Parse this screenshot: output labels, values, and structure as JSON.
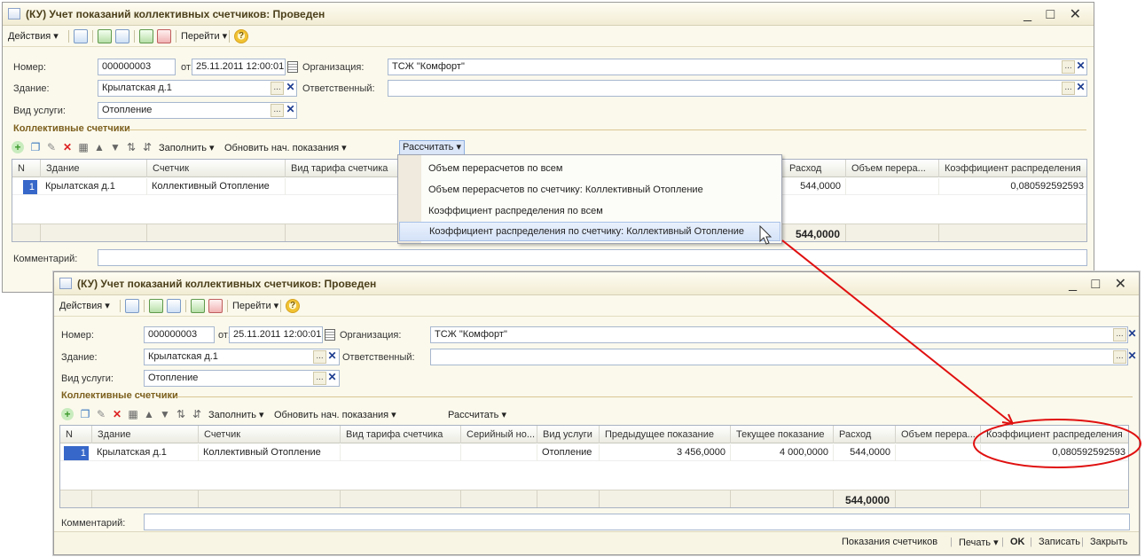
{
  "window": {
    "title": "(КУ) Учет показаний коллективных счетчиков: Проведен",
    "controls": "_ □ ✕"
  },
  "toolbar": {
    "actions": "Действия ▾",
    "goto": "Перейти ▾",
    "help": "?"
  },
  "form": {
    "number_label": "Номер:",
    "number_value": "000000003",
    "date_label": "от:",
    "date_value": "25.11.2011 12:00:01",
    "org_label": "Организация:",
    "org_value": "ТСЖ \"Комфорт\"",
    "building_label": "Здание:",
    "building_value": "Крылатская д.1",
    "responsible_label": "Ответственный:",
    "responsible_value": "",
    "service_label": "Вид услуги:",
    "service_value": "Отопление",
    "dots": "...",
    "clear": "✕"
  },
  "section": {
    "title": "Коллективные счетчики"
  },
  "table_toolbar": {
    "fill": "Заполнить ▾",
    "update": "Обновить нач. показания ▾",
    "calculate": "Рассчитать ▾"
  },
  "table": {
    "headers": [
      "N",
      "Здание",
      "Счетчик",
      "Вид тарифа счетчика",
      "Серийный но...",
      "Вид услуги",
      "Предыдущее показание",
      "Текущее показание",
      "Расход",
      "Объем перера...",
      "Коэффициент распределения"
    ],
    "row": {
      "n": "1",
      "building": "Крылатская д.1",
      "meter": "Коллективный Отопление",
      "tariff": "",
      "serial": "",
      "service": "Отопление",
      "prev": "3 456,0000",
      "curr": "4 000,0000",
      "consumption": "544,0000",
      "recalc": "",
      "coef": "0,080592592593"
    },
    "total_consumption": "544,0000"
  },
  "menu": {
    "items": [
      "Объем перерасчетов по всем",
      "Объем перерасчетов по счетчику: Коллективный Отопление",
      "Коэффициент распределения по всем",
      "Коэффициент распределения по счетчику: Коллективный Отопление"
    ]
  },
  "comment_label": "Комментарий:",
  "bottom": {
    "readings": "Показания счетчиков",
    "print": "Печать ▾",
    "ok": "OK",
    "save": "Записать",
    "close": "Закрыть"
  },
  "colors": {
    "window_bg": "#fbf9ec",
    "section_title": "#7c5f1d",
    "selection_blue": "#3767c9",
    "annotation_red": "#e01010"
  }
}
